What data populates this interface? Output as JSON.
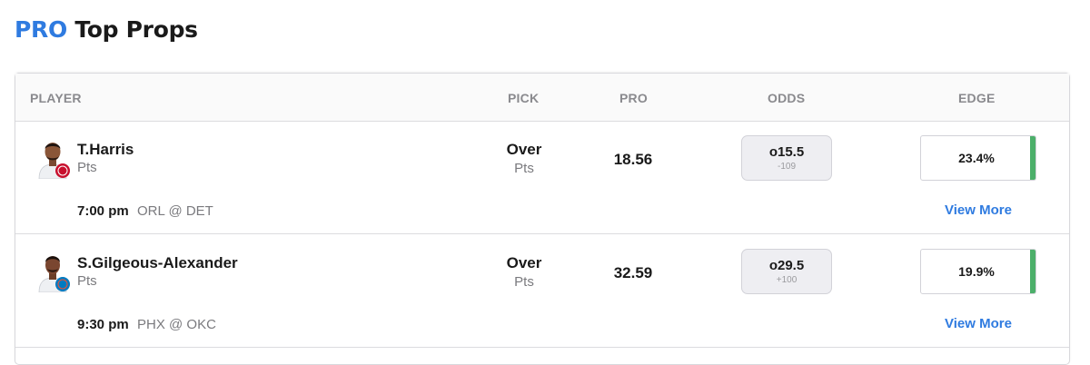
{
  "title": {
    "pro": "PRO",
    "rest": "Top Props"
  },
  "columns": {
    "player": "PLAYER",
    "pick": "PICK",
    "pro": "PRO",
    "odds": "ODDS",
    "edge": "EDGE"
  },
  "rows": [
    {
      "player": "T.Harris",
      "stat": "Pts",
      "time": "7:00 pm",
      "matchup": "ORL @ DET",
      "pick": "Over",
      "pick_stat": "Pts",
      "pro": "18.56",
      "odds_line": "o15.5",
      "odds_price": "-109",
      "edge": "23.4%",
      "view_more": "View More",
      "avatar_team_color": "#c8102e"
    },
    {
      "player": "S.Gilgeous-Alexander",
      "stat": "Pts",
      "time": "9:30 pm",
      "matchup": "PHX @ OKC",
      "pick": "Over",
      "pick_stat": "Pts",
      "pro": "32.59",
      "odds_line": "o29.5",
      "odds_price": "+100",
      "edge": "19.9%",
      "view_more": "View More",
      "avatar_team_color": "#007ac1"
    }
  ],
  "colors": {
    "accent": "#2f7be0",
    "edge_bar": "#4caf6a"
  }
}
